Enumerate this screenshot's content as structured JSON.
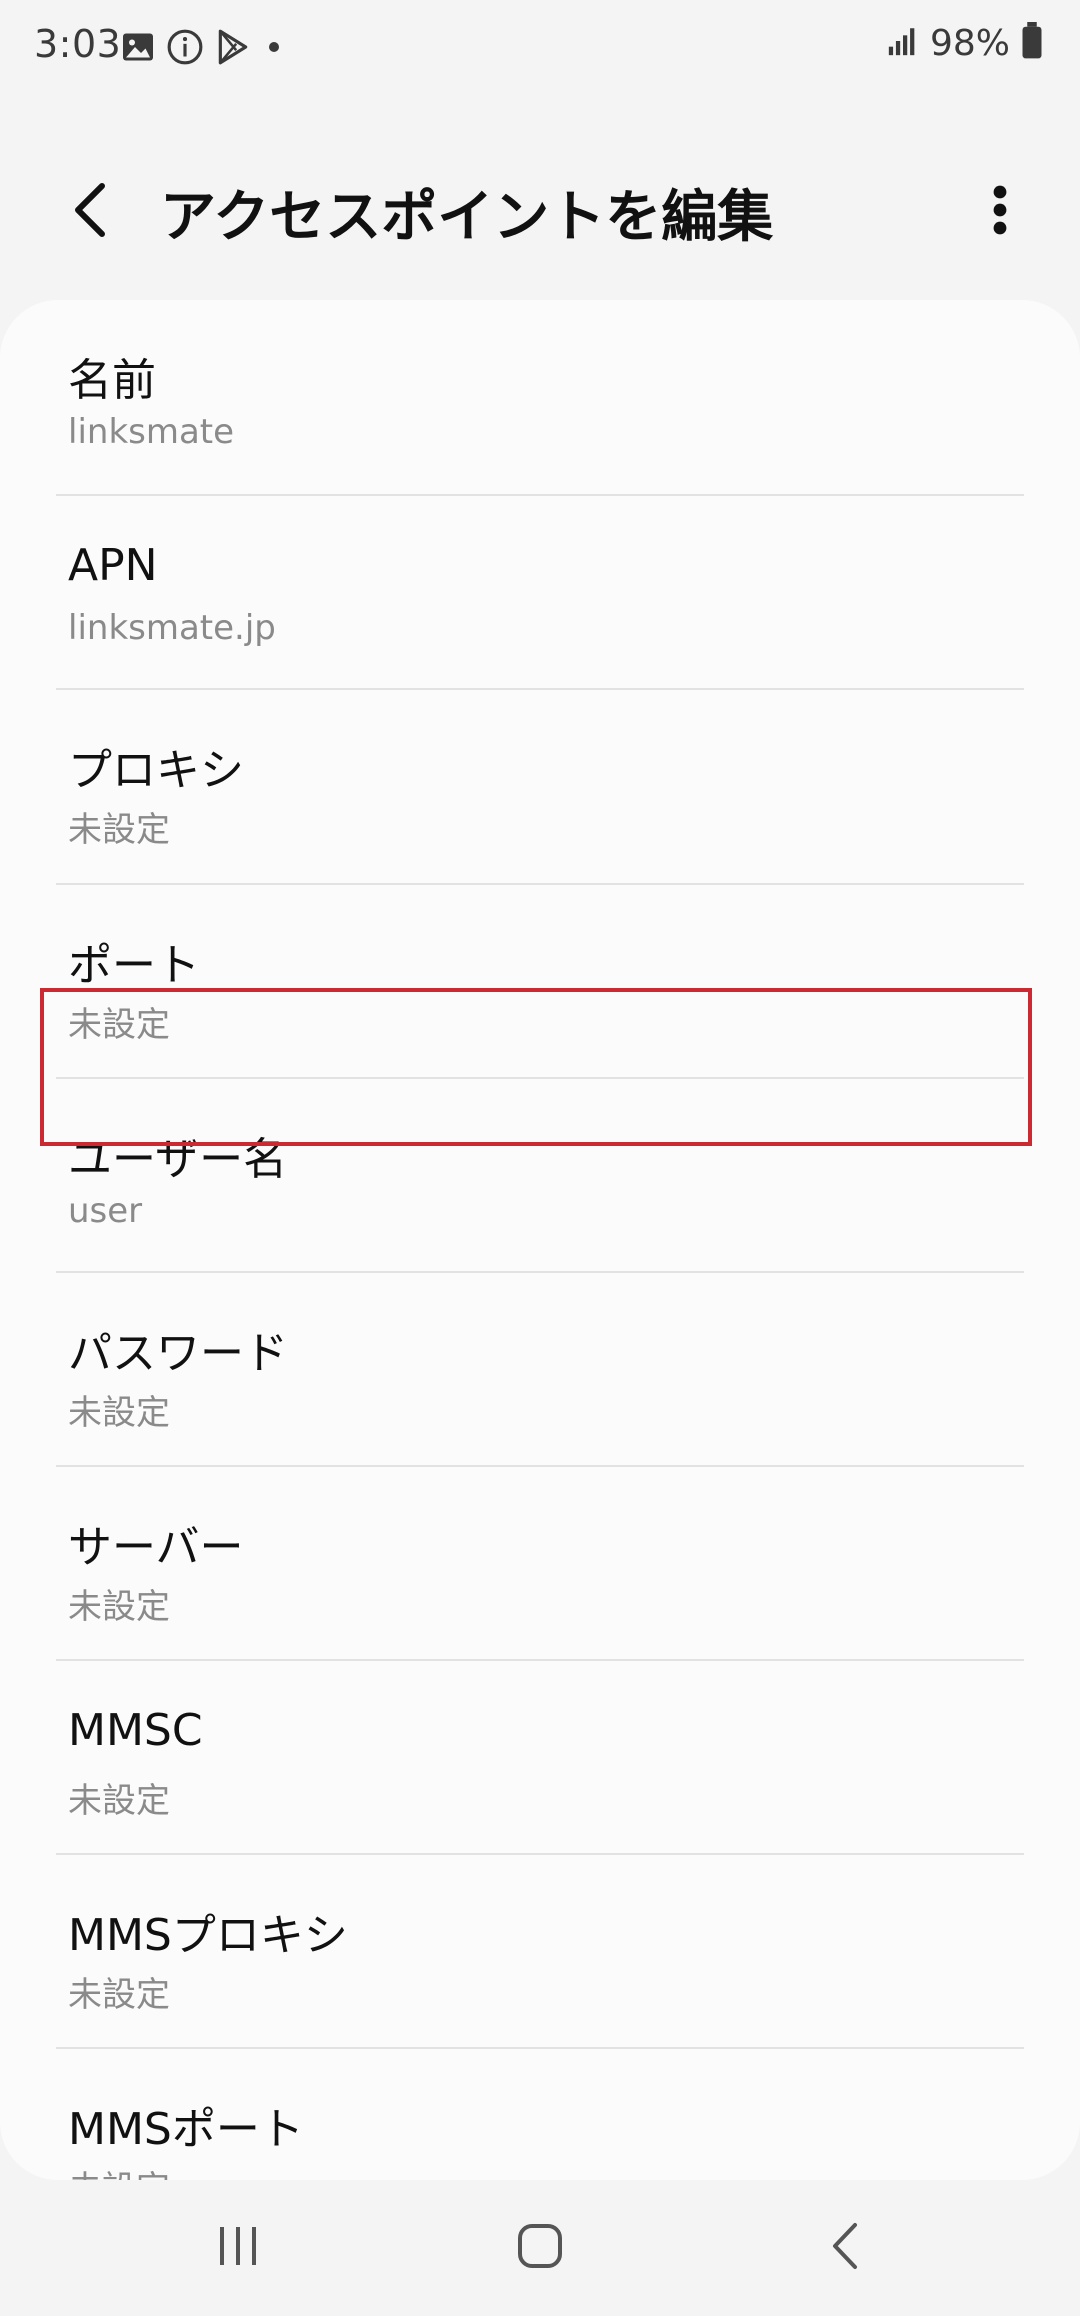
{
  "status_bar": {
    "time": "3:03",
    "battery": "98%",
    "icons_left": [
      "image-icon",
      "info-icon",
      "play-store-icon",
      "dot-icon"
    ],
    "icons_right": [
      "signal-icon",
      "battery-icon"
    ]
  },
  "header": {
    "title": "アクセスポイントを編集",
    "back_icon": "chevron-left-icon",
    "more_icon": "more-vertical-icon"
  },
  "items": [
    {
      "label": "名前",
      "value": "linksmate"
    },
    {
      "label": "APN",
      "value": "linksmate.jp"
    },
    {
      "label": "プロキシ",
      "value": "未設定"
    },
    {
      "label": "ポート",
      "value": "未設定"
    },
    {
      "label": "ユーザー名",
      "value": "user"
    },
    {
      "label": "パスワード",
      "value": "未設定"
    },
    {
      "label": "サーバー",
      "value": "未設定"
    },
    {
      "label": "MMSC",
      "value": "未設定"
    },
    {
      "label": "MMSプロキシ",
      "value": "未設定"
    },
    {
      "label": "MMSポート",
      "value": "未設定"
    }
  ],
  "highlight": {
    "item": "パスワード",
    "color": "#cc2a33"
  },
  "nav_bar": {
    "icons": [
      "recent-apps-icon",
      "home-icon",
      "back-icon"
    ]
  }
}
